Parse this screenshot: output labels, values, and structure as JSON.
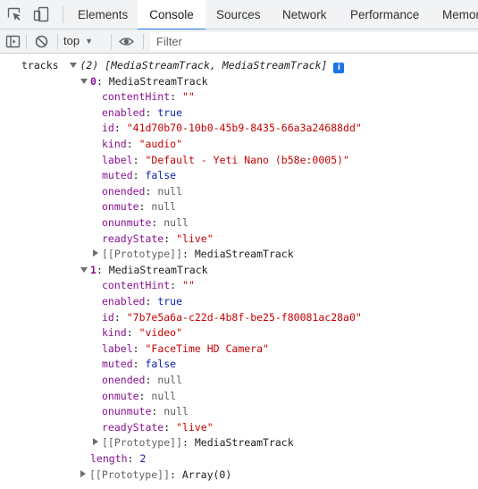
{
  "tabs": [
    {
      "label": "Elements",
      "active": false
    },
    {
      "label": "Console",
      "active": true
    },
    {
      "label": "Sources",
      "active": false
    },
    {
      "label": "Network",
      "active": false
    },
    {
      "label": "Performance",
      "active": false
    },
    {
      "label": "Memor",
      "active": false
    }
  ],
  "toolbar": {
    "context": "top",
    "filter_placeholder": "Filter"
  },
  "console": {
    "root_name": "tracks",
    "root_summary": "(2) [MediaStreamTrack, MediaStreamTrack]",
    "info_badge": "i",
    "items": [
      {
        "index": "0",
        "type": "MediaStreamTrack",
        "props": {
          "contentHint": "\"\"",
          "enabled": "true",
          "id": "\"41d70b70-10b0-45b9-8435-66a3a24688dd\"",
          "kind": "\"audio\"",
          "label": "\"Default - Yeti Nano (b58e:0005)\"",
          "muted": "false",
          "onended": "null",
          "onmute": "null",
          "onunmute": "null",
          "readyState": "\"live\""
        },
        "prototype_key": "[[Prototype]]",
        "prototype_value": "MediaStreamTrack"
      },
      {
        "index": "1",
        "type": "MediaStreamTrack",
        "props": {
          "contentHint": "\"\"",
          "enabled": "true",
          "id": "\"7b7e5a6a-c22d-4b8f-be25-f80081ac28a0\"",
          "kind": "\"video\"",
          "label": "\"FaceTime HD Camera\"",
          "muted": "false",
          "onended": "null",
          "onmute": "null",
          "onunmute": "null",
          "readyState": "\"live\""
        },
        "prototype_key": "[[Prototype]]",
        "prototype_value": "MediaStreamTrack"
      }
    ],
    "length_key": "length",
    "length_value": "2",
    "root_prototype_key": "[[Prototype]]",
    "root_prototype_value": "Array(0)"
  },
  "colors": {
    "accent": "#1a73e8",
    "property_key": "#881391",
    "string_value": "#c80000",
    "boolean_value": "#0d22aa",
    "number_value": "#1a1aa6",
    "null_value": "#5e5e5e"
  }
}
